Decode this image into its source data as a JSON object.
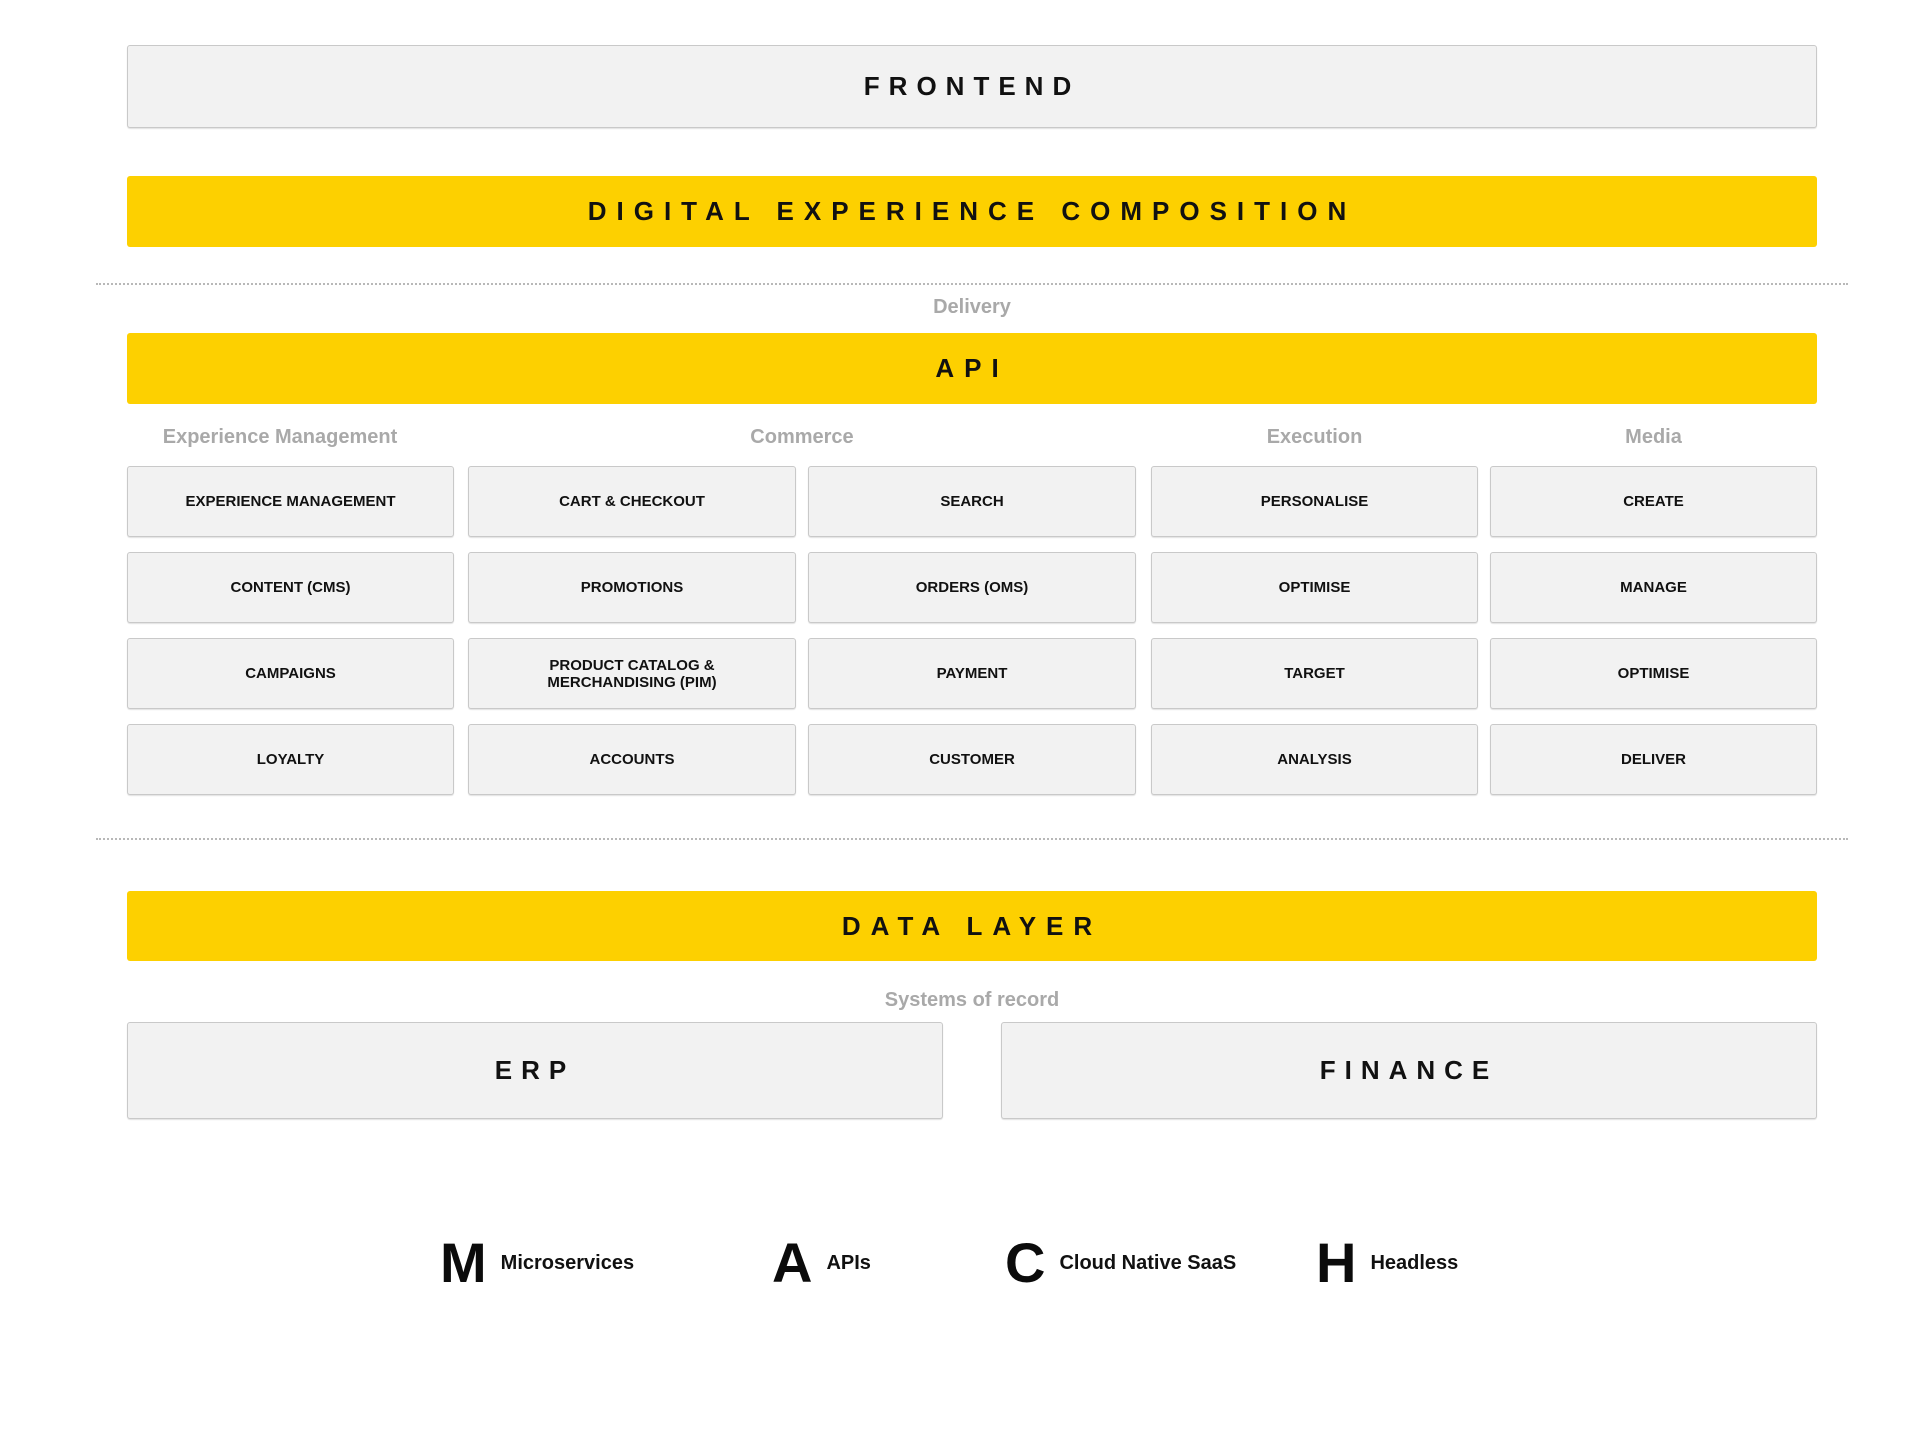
{
  "layers": {
    "frontend": "FRONTEND",
    "composition": "DIGITAL EXPERIENCE COMPOSITION",
    "delivery_caption": "Delivery",
    "api": "API",
    "data_layer": "DATA LAYER",
    "systems_caption": "Systems of record"
  },
  "colors": {
    "accent": "#fdd000",
    "box": "#f2f2f2",
    "caption": "#a9a9a9"
  },
  "categories": [
    {
      "label": "Experience Management"
    },
    {
      "label": "Commerce"
    },
    {
      "label": "Execution"
    },
    {
      "label": "Media"
    }
  ],
  "grid": {
    "columns": [
      [
        "EXPERIENCE MANAGEMENT",
        "CONTENT (CMS)",
        "CAMPAIGNS",
        "LOYALTY"
      ],
      [
        "CART & CHECKOUT",
        "PROMOTIONS",
        "PRODUCT CATALOG & MERCHANDISING (PIM)",
        "ACCOUNTS"
      ],
      [
        "SEARCH",
        "ORDERS (OMS)",
        "PAYMENT",
        "CUSTOMER"
      ],
      [
        "PERSONALISE",
        "OPTIMISE",
        "TARGET",
        "ANALYSIS"
      ],
      [
        "CREATE",
        "MANAGE",
        "OPTIMISE",
        "DELIVER"
      ]
    ]
  },
  "systems": [
    "ERP",
    "FINANCE"
  ],
  "legend": [
    {
      "glyph": "M",
      "label": "Microservices"
    },
    {
      "glyph": "A",
      "label": "APIs"
    },
    {
      "glyph": "C",
      "label": "Cloud Native SaaS"
    },
    {
      "glyph": "H",
      "label": "Headless"
    }
  ]
}
